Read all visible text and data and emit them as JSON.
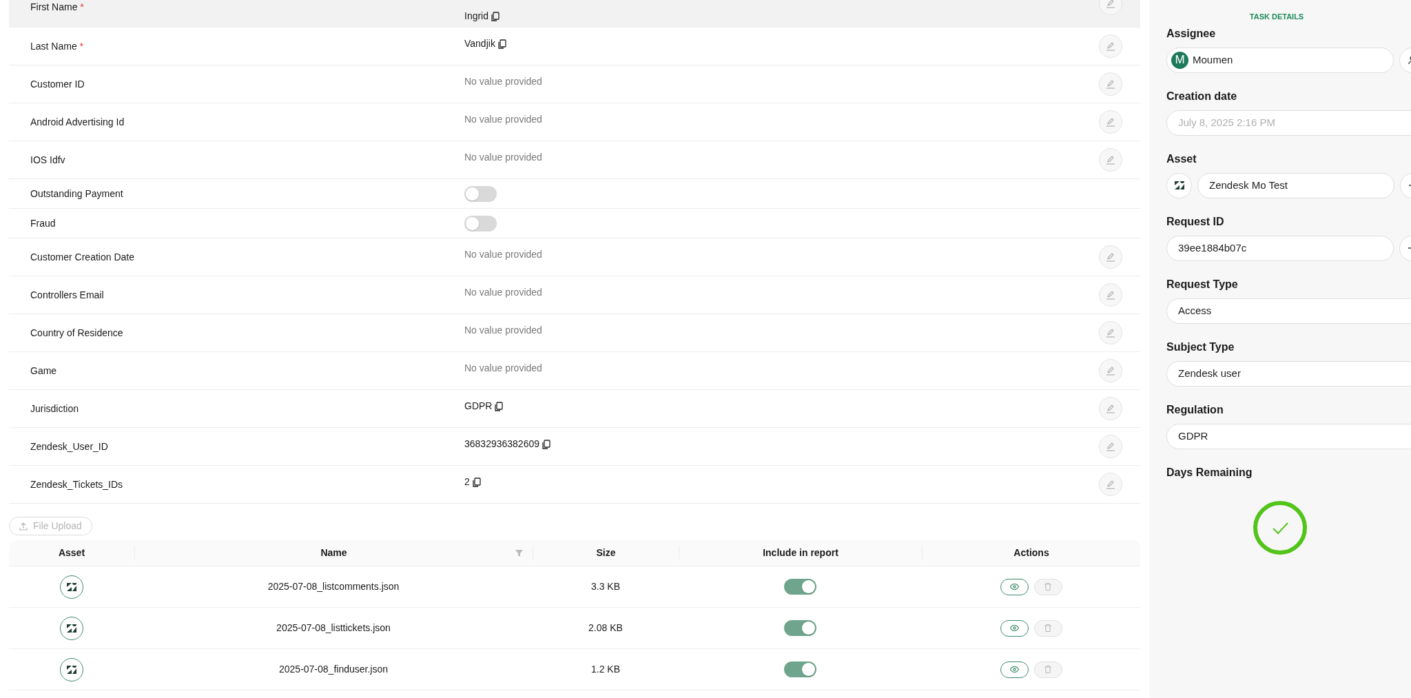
{
  "fields": [
    {
      "label": "First Name",
      "required_mark": "*",
      "kind": "text",
      "value": "Ingrid",
      "highlighted": true
    },
    {
      "label": "Last Name",
      "required_mark": "*",
      "kind": "text",
      "value": "Vandjik"
    },
    {
      "label": "Customer ID",
      "kind": "empty",
      "value": "No value provided"
    },
    {
      "label": "Android Advertising Id",
      "kind": "empty",
      "value": "No value provided"
    },
    {
      "label": "IOS Idfv",
      "kind": "empty",
      "value": "No value provided"
    },
    {
      "label": "Outstanding Payment",
      "kind": "toggle",
      "on": false
    },
    {
      "label": "Fraud",
      "kind": "toggle",
      "on": false
    },
    {
      "label": "Customer Creation Date",
      "kind": "empty",
      "value": "No value provided"
    },
    {
      "label": "Controllers Email",
      "kind": "empty",
      "value": "No value provided"
    },
    {
      "label": "Country of Residence",
      "kind": "empty",
      "value": "No value provided"
    },
    {
      "label": "Game",
      "kind": "empty",
      "value": "No value provided"
    },
    {
      "label": "Jurisdiction",
      "kind": "text",
      "value": "GDPR"
    },
    {
      "label": "Zendesk_User_ID",
      "kind": "text",
      "value": "36832936382609"
    },
    {
      "label": "Zendesk_Tickets_IDs",
      "kind": "text",
      "value": "2"
    }
  ],
  "file_upload": {
    "label": "File Upload",
    "disabled": true
  },
  "table": {
    "columns": [
      "Asset",
      "Name",
      "Size",
      "Include in report",
      "Actions"
    ],
    "rows": [
      {
        "name": "2025-07-08_listcomments.json",
        "size": "3.3 KB",
        "included": true
      },
      {
        "name": "2025-07-08_listtickets.json",
        "size": "2.08 KB",
        "included": true
      },
      {
        "name": "2025-07-08_finduser.json",
        "size": "1.2 KB",
        "included": true
      }
    ]
  },
  "task_details": {
    "title": "TASK DETAILS",
    "assignee": {
      "label": "Assignee",
      "initial": "M",
      "value": "Moumen"
    },
    "creation_date": {
      "label": "Creation date",
      "value": "July 8, 2025 2:16 PM",
      "disabled": true
    },
    "asset": {
      "label": "Asset",
      "value": "Zendesk Mo Test"
    },
    "request_id": {
      "label": "Request ID",
      "value": "39ee1884b07c"
    },
    "request_type": {
      "label": "Request Type",
      "value": "Access"
    },
    "subject_type": {
      "label": "Subject Type",
      "value": "Zendesk user"
    },
    "regulation": {
      "label": "Regulation",
      "value": "GDPR"
    },
    "days_remaining": {
      "label": "Days Remaining"
    }
  }
}
